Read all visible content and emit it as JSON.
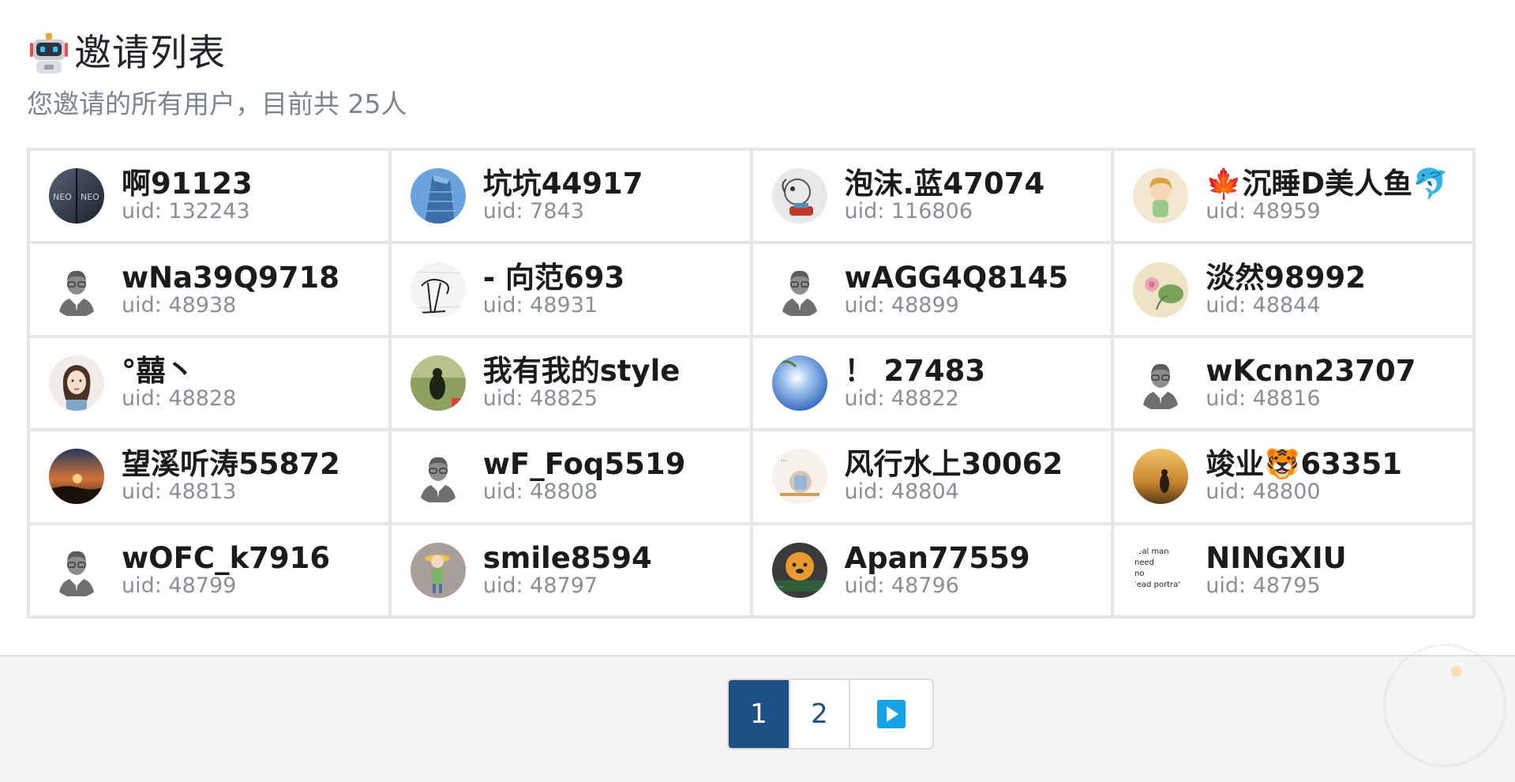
{
  "header": {
    "title": "邀请列表",
    "subtitle": "您邀请的所有用户，目前共 25人",
    "icon": "robot-icon"
  },
  "colors": {
    "accent": "#1e4f86",
    "next_button": "#17a2e8",
    "subtitle": "#7c848d",
    "uid_text": "#8a8f95",
    "border": "#e6e6e6"
  },
  "users": [
    {
      "name": "啊91123",
      "uid": "uid: 132243",
      "avatar": "photo-dark-neo"
    },
    {
      "name": "坑坑44917",
      "uid": "uid: 7843",
      "avatar": "photo-building"
    },
    {
      "name": "泡沫.蓝47074",
      "uid": "uid: 116806",
      "avatar": "photo-sketch"
    },
    {
      "name": "🍁沉睡D美人鱼🐬",
      "uid": "uid: 48959",
      "avatar": "photo-cartoon-girl"
    },
    {
      "name": "wNa39Q9718",
      "uid": "uid: 48938",
      "avatar": "default-person-icon"
    },
    {
      "name": "- 向范693",
      "uid": "uid: 48931",
      "avatar": "photo-doodle"
    },
    {
      "name": "wAGG4Q8145",
      "uid": "uid: 48899",
      "avatar": "default-person-icon"
    },
    {
      "name": "淡然98992",
      "uid": "uid: 48844",
      "avatar": "photo-lotus"
    },
    {
      "name": "°囍丶",
      "uid": "uid: 48828",
      "avatar": "photo-woman"
    },
    {
      "name": "我有我的style",
      "uid": "uid: 48825",
      "avatar": "photo-silhouette"
    },
    {
      "name": "！ 27483",
      "uid": "uid: 48822",
      "avatar": "photo-sky-sphere"
    },
    {
      "name": "wKcnn23707",
      "uid": "uid: 48816",
      "avatar": "default-person-icon"
    },
    {
      "name": "望溪听涛55872",
      "uid": "uid: 48813",
      "avatar": "photo-sunset"
    },
    {
      "name": "wF_Foq5519",
      "uid": "uid: 48808",
      "avatar": "default-person-icon"
    },
    {
      "name": "风行水上30062",
      "uid": "uid: 48804",
      "avatar": "photo-calligraphy"
    },
    {
      "name": "竣业🐯63351",
      "uid": "uid: 48800",
      "avatar": "photo-golden-field"
    },
    {
      "name": "wOFC_k7916",
      "uid": "uid: 48799",
      "avatar": "default-person-icon"
    },
    {
      "name": "smile8594",
      "uid": "uid: 48797",
      "avatar": "photo-cartoon-farmer"
    },
    {
      "name": "Apan77559",
      "uid": "uid: 48796",
      "avatar": "photo-cartoon-dog"
    },
    {
      "name": "NINGXIU",
      "uid": "uid: 48795",
      "avatar": "photo-text-portrait"
    }
  ],
  "text_portrait_lines": [
    ".eal man",
    "need",
    "no",
    "'ead portra'"
  ],
  "pagination": {
    "pages": [
      "1",
      "2"
    ],
    "current": "1",
    "next_icon": "play-next-icon"
  }
}
